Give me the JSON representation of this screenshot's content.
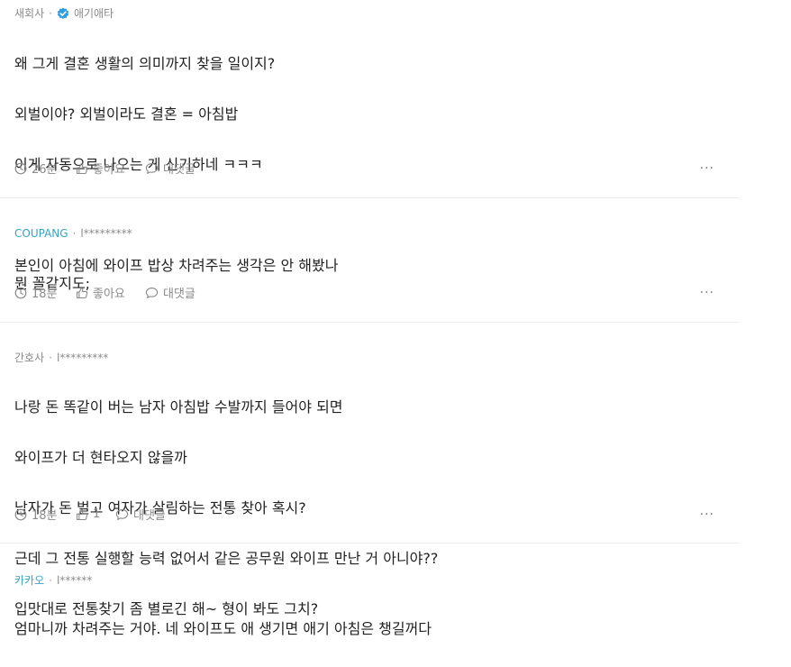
{
  "comments": [
    {
      "company": "새회사",
      "author": "애기애타",
      "verified": true,
      "lines": [
        "왜 그게 결혼 생활의 의미까지 찾을 일이지?",
        "외벌이야? 외벌이라도 결혼 = 아침밥",
        "이게 자동으로 나오는 게 신기하네 ㅋㅋㅋ",
        "",
        "본인이 아침에 와이프 밥상 차려주는 생각은 안 해봤나"
      ],
      "time": "26분",
      "like_label": "좋아요",
      "reply_label": "대댓글",
      "more_label": "···"
    },
    {
      "company": "COUPANG",
      "author": "l*********",
      "verified": false,
      "lines": [
        "뭔 꼴같지도;"
      ],
      "time": "18분",
      "like_label": "좋아요",
      "reply_label": "대댓글",
      "more_label": "···"
    },
    {
      "company": "간호사",
      "author": "l*********",
      "verified": false,
      "lines": [
        "나랑 돈 똑같이 버는 남자 아침밥 수발까지 들어야 되면",
        "와이프가 더 현타오지 않을까",
        "남자가 돈 벌고 여자가 살림하는 전통 찾아 혹시?",
        "근데 그 전통 실행할 능력 없어서 같은 공무원 와이프 만난 거 아니야??",
        "입맛대로 전통찾기 좀 별로긴 해~ 형이 봐도 그치?"
      ],
      "time": "18분",
      "like_label": "1",
      "reply_label": "대댓글",
      "more_label": "···"
    },
    {
      "company": "카카오",
      "author": "l******",
      "verified": false,
      "lines": [
        "엄마니까 차려주는 거야. 네 와이프도 애 생기면 애기 아침은 챙길꺼다"
      ],
      "time": "",
      "like_label": "",
      "reply_label": "",
      "more_label": ""
    }
  ],
  "colors": {
    "company_link": "#3aa2c0",
    "verified_badge": "#2f9fe0",
    "meta_text": "#8a8a8a",
    "body_text": "#222222",
    "divider": "#ececec"
  },
  "icons": {
    "time": "clock-icon",
    "like": "thumbs-up-icon",
    "reply": "speech-bubble-icon",
    "verified": "verified-badge-icon"
  }
}
